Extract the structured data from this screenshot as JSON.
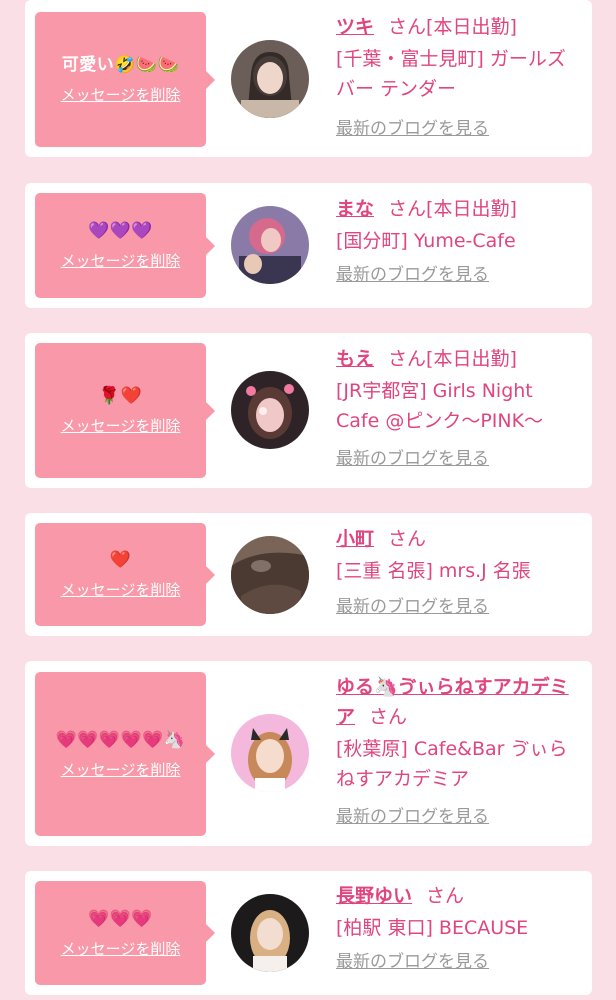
{
  "delete_label": "メッセージを削除",
  "honorific": "さん",
  "blog_label": "最新のブログを見る",
  "cards": [
    {
      "message": "可愛い🤣🍉🍉",
      "name": "ツキ",
      "status": "[本日出勤]",
      "shop": "[千葉・富士見町] ガールズバー テンダー"
    },
    {
      "message": "💜💜💜",
      "name": "まな",
      "status": "[本日出勤]",
      "shop": "[国分町] Yume-Cafe"
    },
    {
      "message": "🌹❤️",
      "name": "もえ",
      "status": "[本日出勤]",
      "shop": "[JR宇都宮] Girls Night Cafe @ピンク〜PINK〜"
    },
    {
      "message": "❤️",
      "name": "小町",
      "status": "",
      "shop": "[三重 名張] mrs.J 名張"
    },
    {
      "message": "💗💗💗💗💗🦄",
      "name": "ゆる🦄ゔぃらねすアカデミア",
      "status": "",
      "shop": "[秋葉原] Cafe&Bar ゔぃらねすアカデミア"
    },
    {
      "message": "💗💗💗",
      "name": "長野ゆい",
      "status": "",
      "shop": "[柏駅 東口] BECAUSE"
    }
  ],
  "colors": {
    "background": "#fadfe7",
    "bubble": "#f998a8",
    "accent": "#e0457f",
    "muted_link": "#9a9a9a"
  }
}
